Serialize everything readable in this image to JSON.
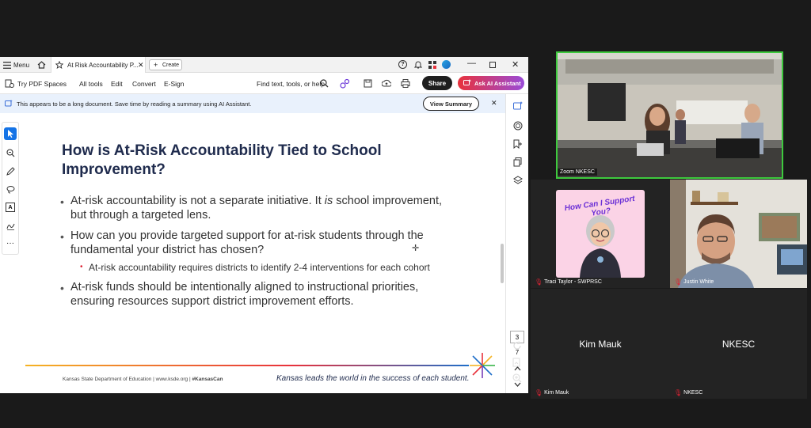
{
  "tabbar": {
    "menu": "Menu",
    "tab_title": "At Risk Accountability P...",
    "create": "Create"
  },
  "toolbar": {
    "try_pdf_spaces": "Try PDF Spaces",
    "all_tools": "All tools",
    "edit": "Edit",
    "convert": "Convert",
    "esign": "E-Sign",
    "find": "Find text, tools, or help",
    "share": "Share",
    "ask_ai": "Ask AI Assistant"
  },
  "notice": {
    "text": "This appears to be a long document. Save time by reading a summary using AI Assistant.",
    "view_summary": "View Summary"
  },
  "slide": {
    "title_line1": "How is At-Risk Accountability Tied to School",
    "title_line2": "Improvement?",
    "b1_line1a": "At-risk accountability is not a separate initiative. It ",
    "b1_italic": "is",
    "b1_line1b": " school improvement,",
    "b1_line2": "but through a targeted lens.",
    "b2_line1": "How can you provide targeted support for at-risk students through the",
    "b2_line2": "fundamental your district has chosen?",
    "sub1": "At-risk accountability requires districts to identify 2-4 interventions for each cohort",
    "b3_line1": "At-risk funds should be intentionally aligned to instructional priorities,",
    "b3_line2": "ensuring resources support district improvement efforts.",
    "footer_left": "Kansas State Department of Education | www.ksde.org | ",
    "footer_hashtag": "#KansasCan",
    "footer_right": "Kansas leads the world in the success of each student."
  },
  "page_nav": {
    "current": "3",
    "total": "7"
  },
  "zoom": {
    "room_label": "Zoom NKESC",
    "traci_name": "Traci Taylor - SWPRSC",
    "traci_avatar_text": "How Can I Support You?",
    "justin_name": "Justin White",
    "kim_big": "Kim Mauk",
    "kim_name": "Kim Mauk",
    "nkesc_big": "NKESC",
    "nkesc_name": "NKESC"
  },
  "colors": {
    "accent_red": "#e8323c",
    "notice_bg": "#e9f1fc",
    "title_navy": "#1f2b4d",
    "active_speaker_green": "#3ec93e"
  }
}
